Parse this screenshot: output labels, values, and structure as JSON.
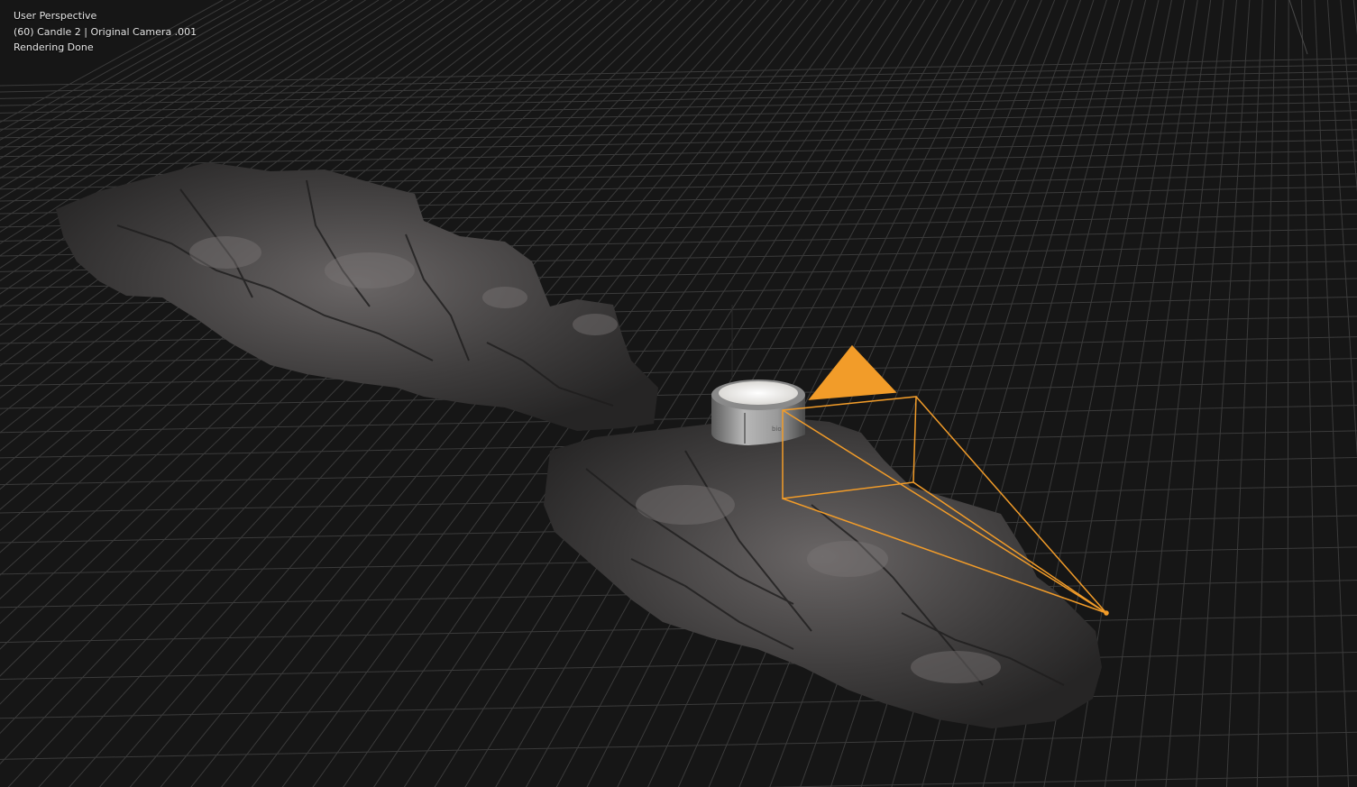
{
  "viewport": {
    "info_lines": [
      "User Perspective",
      "(60) Candle 2 | Original Camera .001",
      "Rendering Done"
    ]
  },
  "scene": {
    "candle_label": "bio",
    "colors": {
      "background": "#161616",
      "grid": "#3b3b3b",
      "rock": "#4a4848",
      "selection": "#f29c29",
      "candle_body": "#8e8e8e",
      "candle_wax": "#f4f2ee"
    }
  }
}
